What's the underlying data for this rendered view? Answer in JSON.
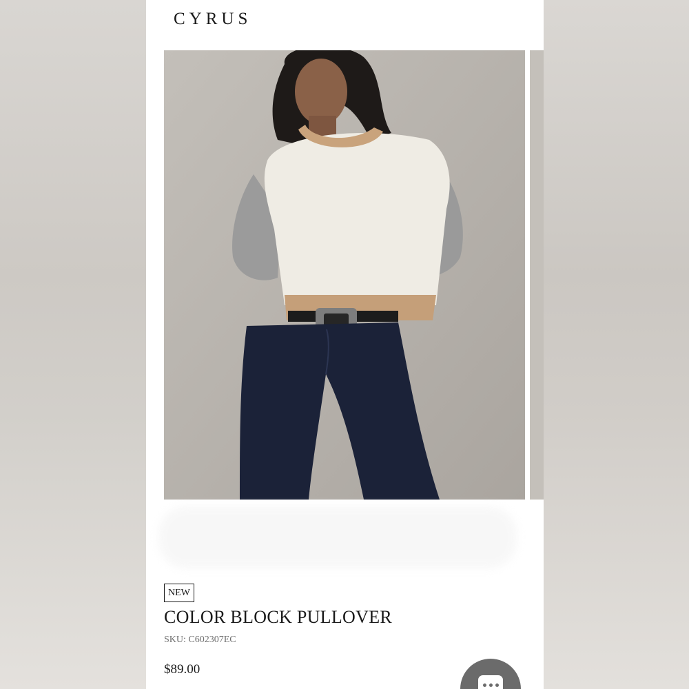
{
  "header": {
    "brand": "CYRUS"
  },
  "gallery": {
    "current_image_alt": "Model wearing color block pullover with dark jeans",
    "image_icon": "product-photo"
  },
  "product": {
    "badge": "NEW",
    "title": "COLOR BLOCK PULLOVER",
    "sku": "SKU: C602307EC",
    "price": "$89.00"
  },
  "chat": {
    "icon": "chat-bubble-icon"
  },
  "colors": {
    "page_background": "#ffffff",
    "text": "#1a1a1a",
    "muted_text": "#6e6e6e",
    "chat_button": "#6b6b6b",
    "photo_background": "#bdb9b3"
  }
}
